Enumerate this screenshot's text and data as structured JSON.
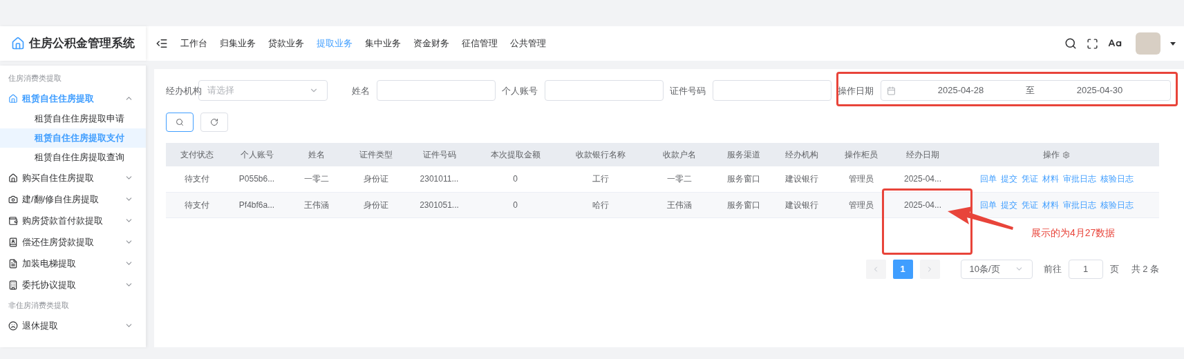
{
  "app": {
    "title": "住房公积金管理系统"
  },
  "nav": [
    {
      "label": "工作台",
      "selected": false
    },
    {
      "label": "归集业务",
      "selected": false
    },
    {
      "label": "贷款业务",
      "selected": false
    },
    {
      "label": "提取业务",
      "selected": true
    },
    {
      "label": "集中业务",
      "selected": false
    },
    {
      "label": "资金财务",
      "selected": false
    },
    {
      "label": "征信管理",
      "selected": false
    },
    {
      "label": "公共管理",
      "selected": false
    }
  ],
  "sidebar": {
    "groups": [
      {
        "title": "住房消费类提取",
        "items": [
          {
            "label": "租赁自住住房提取",
            "expanded": true,
            "children": [
              {
                "label": "租赁自住住房提取申请",
                "selected": false
              },
              {
                "label": "租赁自住住房提取支付",
                "selected": true
              },
              {
                "label": "租赁自住住房提取查询",
                "selected": false
              }
            ]
          },
          {
            "label": "购买自住住房提取",
            "expanded": false
          },
          {
            "label": "建/翻/修自住房提取",
            "expanded": false
          },
          {
            "label": "购房贷款首付款提取",
            "expanded": false
          },
          {
            "label": "偿还住房贷款提取",
            "expanded": false
          },
          {
            "label": "加装电梯提取",
            "expanded": false
          },
          {
            "label": "委托协议提取",
            "expanded": false
          }
        ]
      },
      {
        "title": "非住房消费类提取",
        "items": [
          {
            "label": "退休提取",
            "expanded": false
          }
        ]
      }
    ]
  },
  "filters": [
    {
      "kind": "select",
      "label": "经办机构",
      "placeholder": "请选择"
    },
    {
      "kind": "text",
      "label": "姓名"
    },
    {
      "kind": "text",
      "label": "个人账号"
    },
    {
      "kind": "text",
      "label": "证件号码"
    },
    {
      "kind": "daterange",
      "label": "操作日期",
      "start": "2025-04-28",
      "separator": "至",
      "end": "2025-04-30"
    }
  ],
  "table": {
    "columns": [
      "支付状态",
      "个人账号",
      "姓名",
      "证件类型",
      "证件号码",
      "本次提取金额",
      "收款银行名称",
      "收款户名",
      "服务渠道",
      "经办机构",
      "操作柜员",
      "经办日期",
      "操作"
    ],
    "rows": [
      {
        "cells": [
          "待支付",
          "P055b6...",
          "一零二",
          "身份证",
          "2301011...",
          "0",
          "工行",
          "一零二",
          "服务窗口",
          "建设银行",
          "管理员",
          "2025-04..."
        ],
        "actions": [
          "回单",
          "提交",
          "凭证",
          "材料",
          "审批日志",
          "核验日志"
        ]
      },
      {
        "cells": [
          "待支付",
          "Pf4bf6a...",
          "王伟涵",
          "身份证",
          "2301051...",
          "0",
          "哈行",
          "王伟涵",
          "服务窗口",
          "建设银行",
          "管理员",
          "2025-04..."
        ],
        "actions": [
          "回单",
          "提交",
          "凭证",
          "材料",
          "审批日志",
          "核验日志"
        ]
      }
    ]
  },
  "pagination": {
    "pages": [
      {
        "label": "1",
        "selected": true
      }
    ],
    "page_size": "10条/页",
    "goto_label": "前往",
    "goto_value": "1",
    "page_unit": "页",
    "total": "共 2 条"
  },
  "annotation": {
    "text": "展示的为4月27数据"
  }
}
